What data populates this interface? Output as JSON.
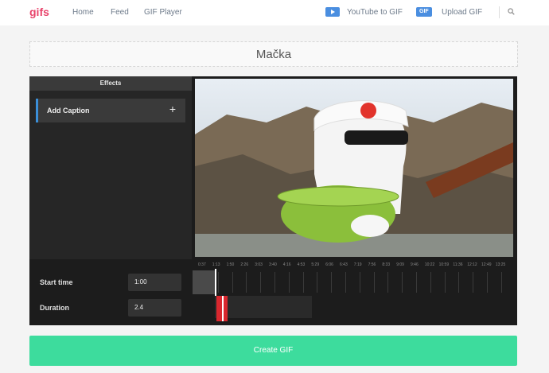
{
  "nav": {
    "logo": "gifs",
    "links": [
      "Home",
      "Feed",
      "GIF Player"
    ],
    "youtube_label": "YouTube to GIF",
    "upload_badge": "GIF",
    "upload_label": "Upload GIF"
  },
  "title": "Mačka",
  "effects": {
    "header": "Effects",
    "add_caption": "Add Caption",
    "add_caption_plus": "+"
  },
  "controls": {
    "start_label": "Start time",
    "start_value": "1:00",
    "duration_label": "Duration",
    "duration_value": "2.4"
  },
  "timeline": {
    "ticks": [
      "0:37",
      "1:13",
      "1:50",
      "2:26",
      "3:03",
      "3:40",
      "4:16",
      "4:53",
      "5:29",
      "6:06",
      "6:43",
      "7:19",
      "7:56",
      "8:33",
      "9:09",
      "9:46",
      "10:22",
      "10:59",
      "11:36",
      "12:12",
      "12:49",
      "13:25"
    ]
  },
  "create_button": "Create GIF",
  "colors": {
    "accent": "#3ddc9d",
    "logo": "#e8426a",
    "highlight": "#3b8fd8",
    "selection": "#d9272e"
  }
}
